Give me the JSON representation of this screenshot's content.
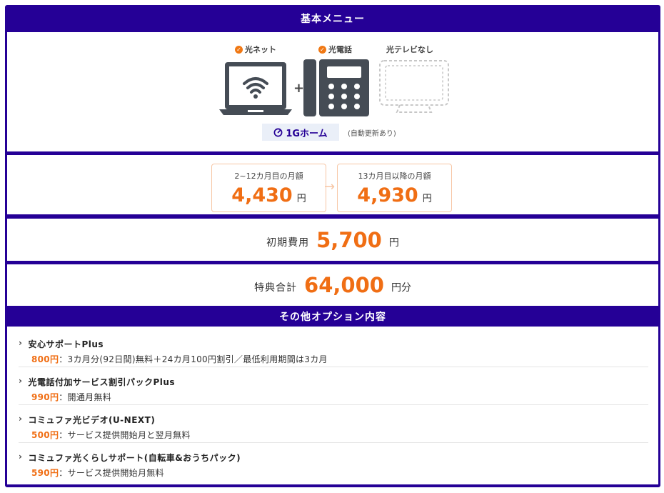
{
  "header": {
    "title": "基本メニュー"
  },
  "base_menu": {
    "services": [
      {
        "label": "光ネット",
        "included": true,
        "icon": "laptop-wifi-icon"
      },
      {
        "label": "光電話",
        "included": true,
        "icon": "desk-phone-icon"
      },
      {
        "label": "光テレビなし",
        "included": false,
        "icon": "tv-outline-icon"
      }
    ],
    "plus": "+",
    "plan": {
      "name": "1Gホーム",
      "icon": "speedometer-icon",
      "note": "(自動更新あり)"
    }
  },
  "monthly": {
    "first": {
      "caption": "2~12カ月目の月額",
      "amount": "4,430",
      "unit": "円"
    },
    "arrow": "→",
    "second": {
      "caption": "13カ月目以降の月額",
      "amount": "4,930",
      "unit": "円"
    }
  },
  "initial_cost": {
    "label": "初期費用",
    "amount": "5,700",
    "unit": "円"
  },
  "benefit_total": {
    "label": "特典合計",
    "amount": "64,000",
    "unit": "円分"
  },
  "options": {
    "title": "その他オプション内容",
    "items": [
      {
        "name": "安心サポートPlus",
        "price": "800円",
        "desc": "：3カ月分(92日間)無料＋24カ月100円割引／最低利用期間は3カ月"
      },
      {
        "name": "光電話付加サービス割引パックPlus",
        "price": "990円",
        "desc": "：開通月無料"
      },
      {
        "name": "コミュファ光ビデオ(U-NEXT)",
        "price": "500円",
        "desc": "：サービス提供開始月と翌月無料"
      },
      {
        "name": "コミュファ光くらしサポート(自転車&おうちパック)",
        "price": "590円",
        "desc": "：サービス提供開始月無料"
      }
    ]
  },
  "colors": {
    "brand": "#250096",
    "accent": "#f06e14",
    "check": "#f07814",
    "border_light": "#f7c6a4"
  }
}
